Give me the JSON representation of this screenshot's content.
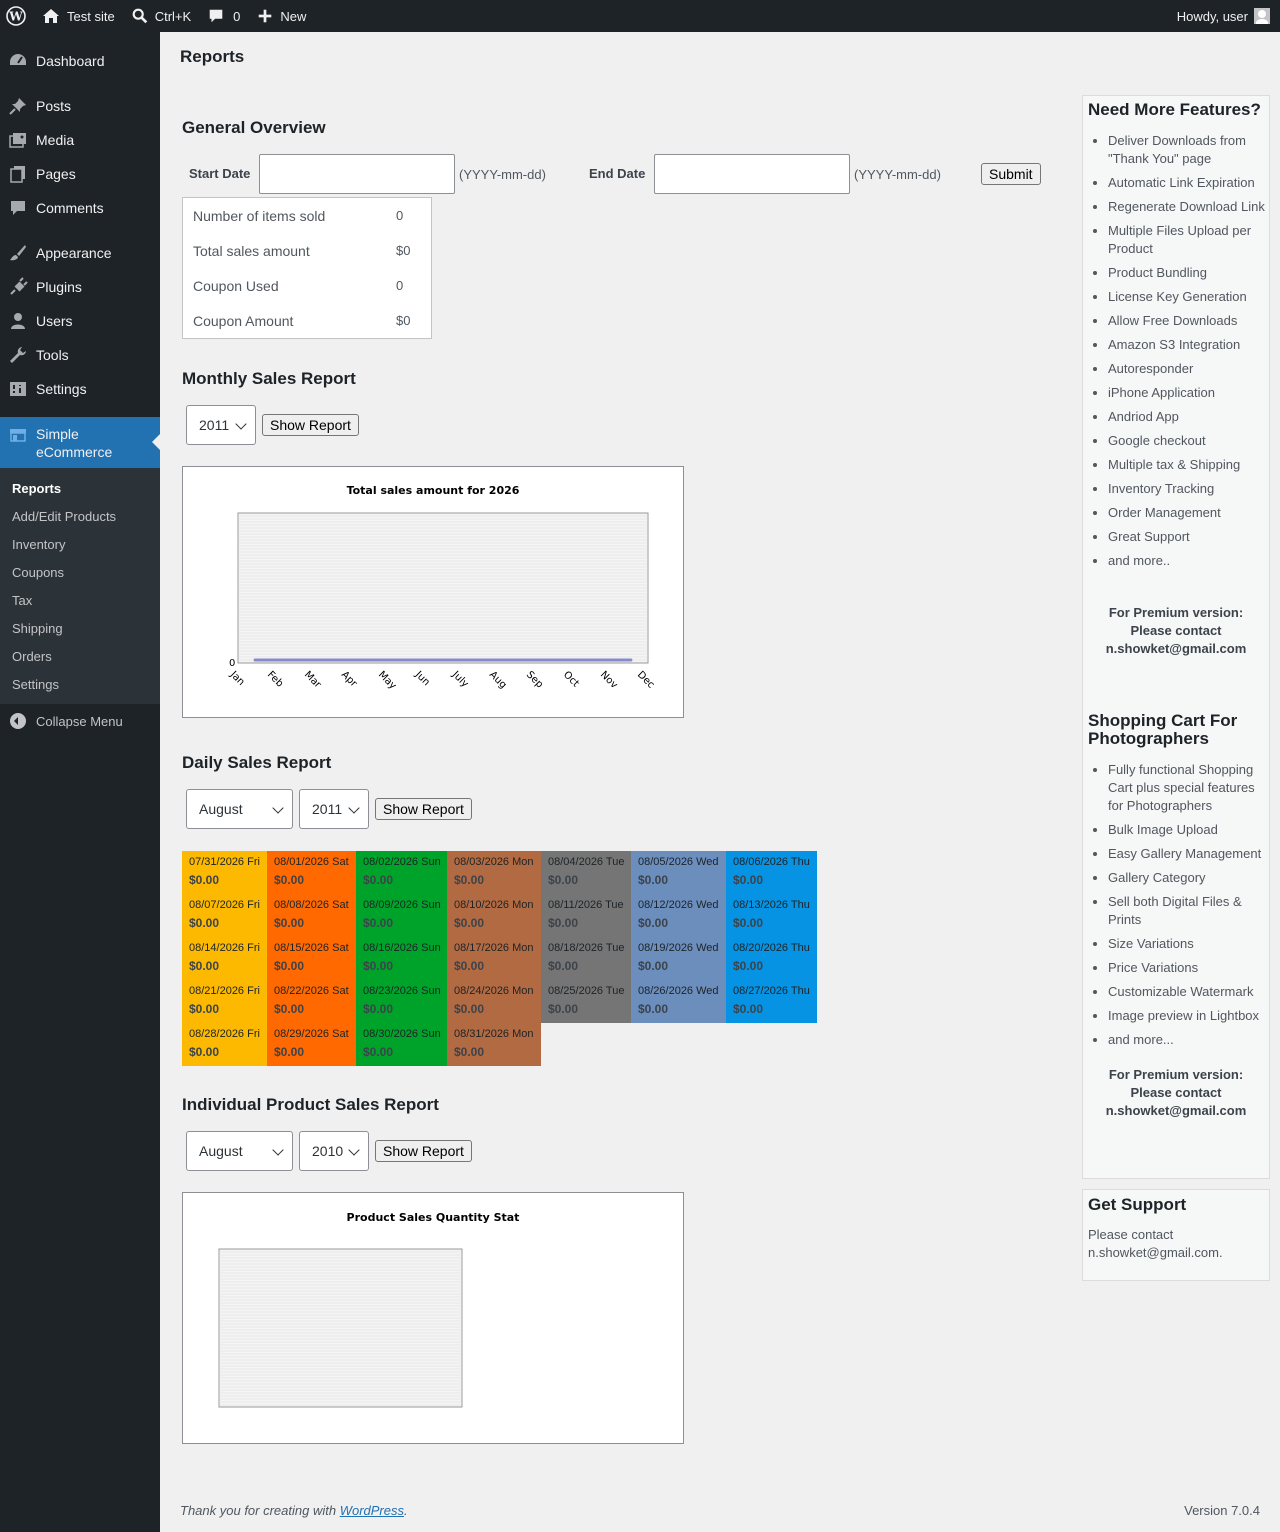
{
  "adminbar": {
    "site_name": "Test site",
    "search_shortcut": "Ctrl+K",
    "comments_count": "0",
    "new_label": "New",
    "greeting": "Howdy, user"
  },
  "sidebar": {
    "items": [
      {
        "label": "Dashboard",
        "icon": "dashboard-icon"
      },
      {
        "label": "Posts",
        "icon": "pushpin-icon"
      },
      {
        "label": "Media",
        "icon": "media-icon"
      },
      {
        "label": "Pages",
        "icon": "pages-icon"
      },
      {
        "label": "Comments",
        "icon": "comment-icon"
      },
      {
        "label": "Appearance",
        "icon": "paintbrush-icon"
      },
      {
        "label": "Plugins",
        "icon": "plugin-icon"
      },
      {
        "label": "Users",
        "icon": "user-icon"
      },
      {
        "label": "Tools",
        "icon": "wrench-icon"
      },
      {
        "label": "Settings",
        "icon": "sliders-icon"
      }
    ],
    "active": {
      "label_line1": "Simple",
      "label_line2": "eCommerce",
      "icon": "store-icon"
    },
    "submenu": [
      "Reports",
      "Add/Edit Products",
      "Inventory",
      "Coupons",
      "Tax",
      "Shipping",
      "Orders",
      "Settings"
    ],
    "collapse_label": "Collapse Menu"
  },
  "page": {
    "title": "Reports"
  },
  "overview": {
    "heading": "General Overview",
    "start_label": "Start Date",
    "end_label": "End Date",
    "date_hint": "(YYYY-mm-dd)",
    "submit_label": "Submit",
    "rows": [
      {
        "label": "Number of items sold",
        "value": "0"
      },
      {
        "label": "Total sales amount",
        "value": "$0"
      },
      {
        "label": "Coupon Used",
        "value": "0"
      },
      {
        "label": "Coupon Amount",
        "value": "$0"
      }
    ]
  },
  "monthly": {
    "heading": "Monthly Sales Report",
    "year": "2011",
    "button": "Show Report"
  },
  "daily": {
    "heading": "Daily Sales Report",
    "month": "August",
    "year": "2011",
    "button": "Show Report",
    "weekday_colors": {
      "Fri": "#fcb900",
      "Sat": "#ff6900",
      "Sun": "#00a32a",
      "Mon": "#b26a42",
      "Tue": "#757575",
      "Wed": "#6b8ebd",
      "Thu": "#0693e3"
    },
    "days": [
      {
        "date": "07/31/2026 Fri",
        "amount": "$0.00"
      },
      {
        "date": "08/01/2026 Sat",
        "amount": "$0.00"
      },
      {
        "date": "08/02/2026 Sun",
        "amount": "$0.00"
      },
      {
        "date": "08/03/2026 Mon",
        "amount": "$0.00"
      },
      {
        "date": "08/04/2026 Tue",
        "amount": "$0.00"
      },
      {
        "date": "08/05/2026 Wed",
        "amount": "$0.00"
      },
      {
        "date": "08/06/2026 Thu",
        "amount": "$0.00"
      },
      {
        "date": "08/07/2026 Fri",
        "amount": "$0.00"
      },
      {
        "date": "08/08/2026 Sat",
        "amount": "$0.00"
      },
      {
        "date": "08/09/2026 Sun",
        "amount": "$0.00"
      },
      {
        "date": "08/10/2026 Mon",
        "amount": "$0.00"
      },
      {
        "date": "08/11/2026 Tue",
        "amount": "$0.00"
      },
      {
        "date": "08/12/2026 Wed",
        "amount": "$0.00"
      },
      {
        "date": "08/13/2026 Thu",
        "amount": "$0.00"
      },
      {
        "date": "08/14/2026 Fri",
        "amount": "$0.00"
      },
      {
        "date": "08/15/2026 Sat",
        "amount": "$0.00"
      },
      {
        "date": "08/16/2026 Sun",
        "amount": "$0.00"
      },
      {
        "date": "08/17/2026 Mon",
        "amount": "$0.00"
      },
      {
        "date": "08/18/2026 Tue",
        "amount": "$0.00"
      },
      {
        "date": "08/19/2026 Wed",
        "amount": "$0.00"
      },
      {
        "date": "08/20/2026 Thu",
        "amount": "$0.00"
      },
      {
        "date": "08/21/2026 Fri",
        "amount": "$0.00"
      },
      {
        "date": "08/22/2026 Sat",
        "amount": "$0.00"
      },
      {
        "date": "08/23/2026 Sun",
        "amount": "$0.00"
      },
      {
        "date": "08/24/2026 Mon",
        "amount": "$0.00"
      },
      {
        "date": "08/25/2026 Tue",
        "amount": "$0.00"
      },
      {
        "date": "08/26/2026 Wed",
        "amount": "$0.00"
      },
      {
        "date": "08/27/2026 Thu",
        "amount": "$0.00"
      },
      {
        "date": "08/28/2026 Fri",
        "amount": "$0.00"
      },
      {
        "date": "08/29/2026 Sat",
        "amount": "$0.00"
      },
      {
        "date": "08/30/2026 Sun",
        "amount": "$0.00"
      },
      {
        "date": "08/31/2026 Mon",
        "amount": "$0.00"
      }
    ]
  },
  "product": {
    "heading": "Individual Product Sales Report",
    "month": "August",
    "year": "2010",
    "button": "Show Report"
  },
  "chart_data": [
    {
      "type": "line",
      "title": "Total sales amount for 2026",
      "categories": [
        "Jan",
        "Feb",
        "Mar",
        "Apr",
        "May",
        "Jun",
        "July",
        "Aug",
        "Sep",
        "Oct",
        "Nov",
        "Dec"
      ],
      "values": [
        0,
        0,
        0,
        0,
        0,
        0,
        0,
        0,
        0,
        0,
        0,
        0
      ],
      "ytick": "0",
      "line_color": "#8888cc"
    },
    {
      "type": "bar",
      "title": "Product Sales Quantity Stat",
      "categories": [],
      "values": []
    }
  ],
  "features_box": {
    "heading": "Need More Features?",
    "items": [
      "Deliver Downloads from \"Thank You\" page",
      "Automatic Link Expiration",
      "Regenerate Download Link",
      "Multiple Files Upload per Product",
      "Product Bundling",
      "License Key Generation",
      "Allow Free Downloads",
      "Amazon S3 Integration",
      "Autoresponder",
      "iPhone Application",
      "Andriod App",
      "Google checkout",
      "Multiple tax & Shipping",
      "Inventory Tracking",
      "Order Management",
      "Great Support",
      "and more.."
    ],
    "premium_line1": "For Premium version:",
    "premium_line2": "Please contact",
    "premium_email": "n.showket@gmail.com",
    "heading2_line1": "Shopping Cart For",
    "heading2_line2": "Photographers",
    "items2": [
      "Fully functional Shopping Cart plus special features for Photographers",
      "Bulk Image Upload",
      "Easy Gallery Management",
      "Gallery Category",
      "Sell both Digital Files & Prints",
      "Size Variations",
      "Price Variations",
      "Customizable Watermark",
      "Image preview in Lightbox",
      "and more..."
    ]
  },
  "support_box": {
    "heading": "Get Support",
    "line1": "Please contact",
    "line2": "n.showket@gmail.com."
  },
  "footer": {
    "thanks_prefix": "Thank you for creating with ",
    "link_text": "WordPress",
    "thanks_suffix": ".",
    "version": "Version 7.0.4"
  }
}
